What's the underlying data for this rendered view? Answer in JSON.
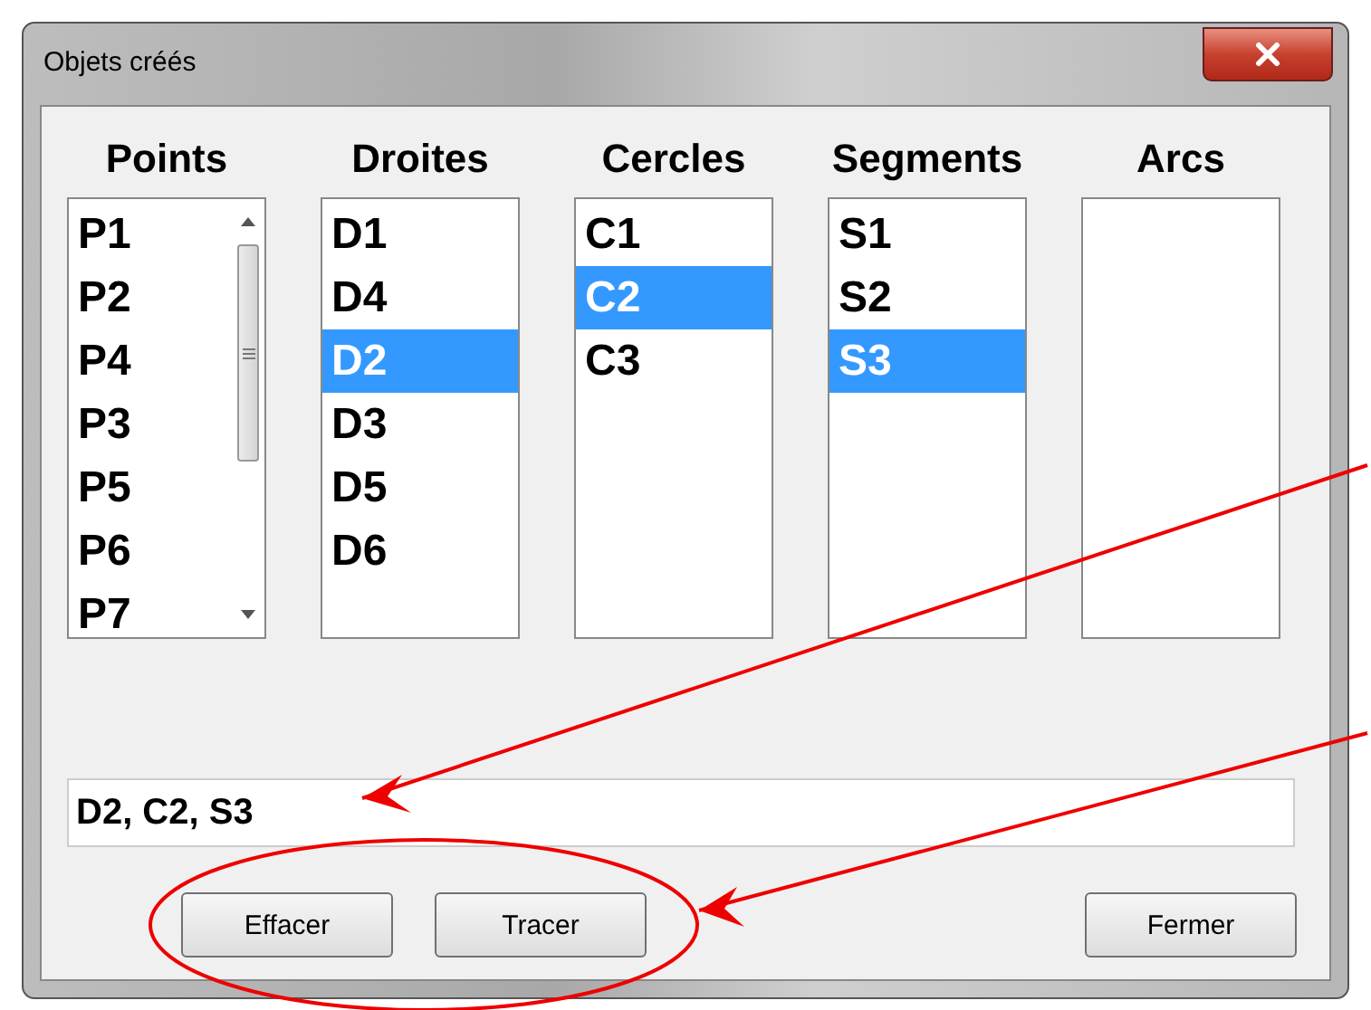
{
  "window": {
    "title": "Objets créés"
  },
  "lists": [
    {
      "header": "Points",
      "scrollable": true,
      "items": [
        {
          "label": "P1",
          "selected": false
        },
        {
          "label": "P2",
          "selected": false
        },
        {
          "label": "P4",
          "selected": false
        },
        {
          "label": "P3",
          "selected": false
        },
        {
          "label": "P5",
          "selected": false
        },
        {
          "label": "P6",
          "selected": false
        },
        {
          "label": "P7",
          "selected": false
        }
      ]
    },
    {
      "header": "Droites",
      "scrollable": false,
      "items": [
        {
          "label": "D1",
          "selected": false
        },
        {
          "label": "D4",
          "selected": false
        },
        {
          "label": "D2",
          "selected": true
        },
        {
          "label": "D3",
          "selected": false
        },
        {
          "label": "D5",
          "selected": false
        },
        {
          "label": "D6",
          "selected": false
        }
      ]
    },
    {
      "header": "Cercles",
      "scrollable": false,
      "items": [
        {
          "label": "C1",
          "selected": false
        },
        {
          "label": "C2",
          "selected": true
        },
        {
          "label": "C3",
          "selected": false
        }
      ]
    },
    {
      "header": "Segments",
      "scrollable": false,
      "items": [
        {
          "label": "S1",
          "selected": false
        },
        {
          "label": "S2",
          "selected": false
        },
        {
          "label": "S3",
          "selected": true
        }
      ]
    },
    {
      "header": "Arcs",
      "scrollable": false
    }
  ],
  "selection_field": {
    "value": "D2, C2, S3"
  },
  "action_buttons": [
    "Effacer",
    "Tracer"
  ],
  "close_button": "Fermer"
}
